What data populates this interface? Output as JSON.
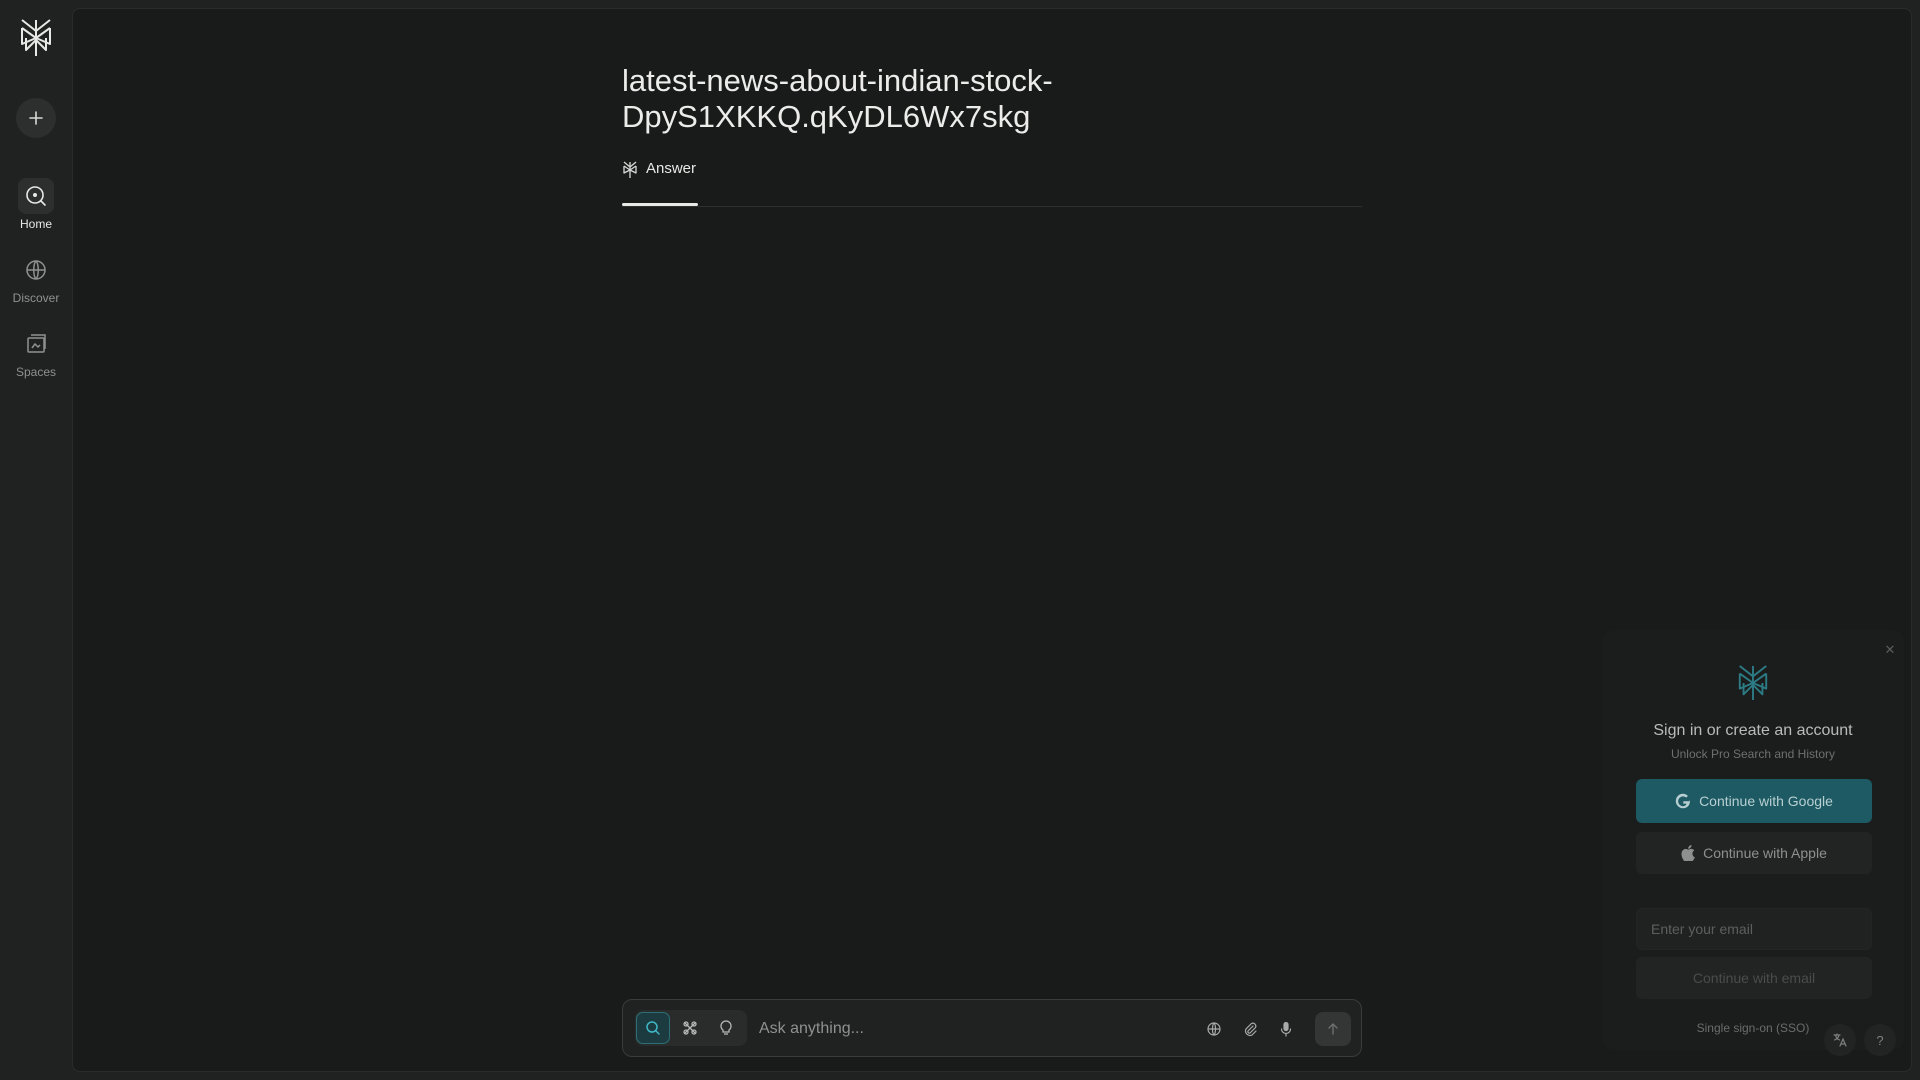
{
  "sidebar": {
    "logo_icon": "perplexity-logo-icon",
    "new_thread_icon": "plus-icon",
    "items": [
      {
        "label": "Home",
        "icon": "search-circle-icon",
        "active": true
      },
      {
        "label": "Discover",
        "icon": "globe-icon",
        "active": false
      },
      {
        "label": "Spaces",
        "icon": "spaces-icon",
        "active": false
      }
    ]
  },
  "thread": {
    "title": "latest-news-about-indian-stock-DpyS1XKKQ.qKyDL6Wx7skg",
    "tabs": [
      {
        "label": "Answer",
        "icon": "perplexity-small-icon",
        "active": true
      }
    ]
  },
  "askbar": {
    "placeholder": "Ask anything...",
    "modes": [
      {
        "name": "search",
        "icon": "search-icon",
        "active": true
      },
      {
        "name": "research",
        "icon": "research-icon",
        "active": false
      },
      {
        "name": "labs",
        "icon": "lightbulb-icon",
        "active": false
      }
    ],
    "tools": [
      "globe-icon",
      "paperclip-icon",
      "microphone-icon"
    ],
    "submit_icon": "arrow-up-icon"
  },
  "signin": {
    "title": "Sign in or create an account",
    "subtitle": "Unlock Pro Search and History",
    "google_label": "Continue with Google",
    "apple_label": "Continue with Apple",
    "email_placeholder": "Enter your email",
    "email_button": "Continue with email",
    "sso_label": "Single sign-on (SSO)"
  },
  "corner": {
    "language_icon": "translate-icon",
    "help_label": "?"
  },
  "colors": {
    "background": "#191a1a",
    "sidebar": "#202222",
    "accent": "#1e5a63",
    "text": "#e8e8e6"
  }
}
